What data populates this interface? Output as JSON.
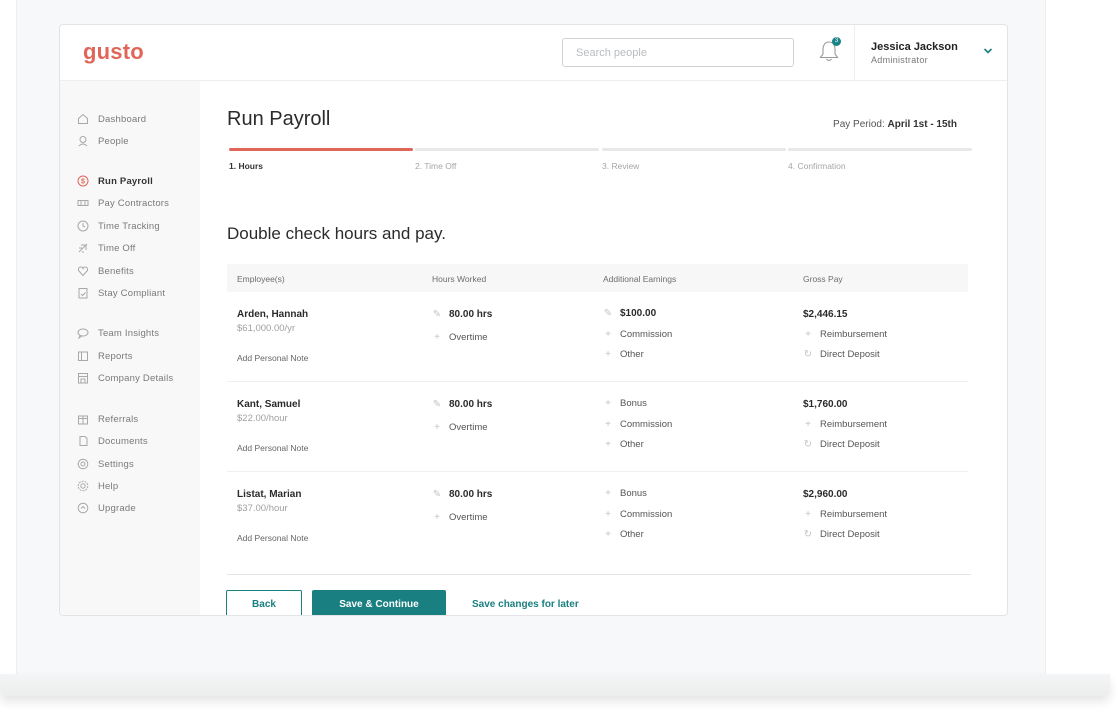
{
  "header": {
    "logo": "gusto",
    "search_placeholder": "Search people",
    "notification_count": "3",
    "user_name": "Jessica Jackson",
    "user_role": "Administrator"
  },
  "sidebar": {
    "items": [
      {
        "label": "Dashboard",
        "icon": "home-icon"
      },
      {
        "label": "People",
        "icon": "person-icon"
      },
      {
        "label": "Run Payroll",
        "icon": "dollar-icon",
        "active": true
      },
      {
        "label": "Pay Contractors",
        "icon": "cash-icon"
      },
      {
        "label": "Time Tracking",
        "icon": "clock-icon"
      },
      {
        "label": "Time Off",
        "icon": "airplane-icon"
      },
      {
        "label": "Benefits",
        "icon": "heart-icon"
      },
      {
        "label": "Stay Compliant",
        "icon": "clipboard-check-icon"
      },
      {
        "label": "Team Insights",
        "icon": "chat-bubble-icon"
      },
      {
        "label": "Reports",
        "icon": "folder-icon"
      },
      {
        "label": "Company Details",
        "icon": "building-icon"
      },
      {
        "label": "Referrals",
        "icon": "gift-icon"
      },
      {
        "label": "Documents",
        "icon": "document-icon"
      },
      {
        "label": "Settings",
        "icon": "gear-icon"
      },
      {
        "label": "Help",
        "icon": "help-icon"
      },
      {
        "label": "Upgrade",
        "icon": "upgrade-icon"
      }
    ]
  },
  "main": {
    "title": "Run Payroll",
    "pay_period_label": "Pay Period:",
    "pay_period_value": "April 1st - 15th",
    "steps": [
      {
        "label": "1. Hours",
        "complete": true
      },
      {
        "label": "2. Time Off",
        "complete": false
      },
      {
        "label": "3. Review",
        "complete": false
      },
      {
        "label": "4. Confirmation",
        "complete": false
      }
    ],
    "subtitle": "Double check hours and pay.",
    "table": {
      "headers": [
        "Employee(s)",
        "Hours Worked",
        "Additional Earnings",
        "Gross Pay"
      ],
      "rows": [
        {
          "name": "Arden, Hannah",
          "rate": "$61,000.00/yr",
          "note": "Add Personal Note",
          "hours": "80.00 hrs",
          "overtime": "Overtime",
          "earnings": [
            "$100.00",
            "Commission",
            "Other"
          ],
          "gross": "$2,446.15",
          "reimbursement": "Reimbursement",
          "deposit": "Direct Deposit"
        },
        {
          "name": "Kant, Samuel",
          "rate": "$22.00/hour",
          "note": "Add Personal Note",
          "hours": "80.00 hrs",
          "overtime": "Overtime",
          "earnings": [
            "Bonus",
            "Commission",
            "Other"
          ],
          "gross": "$1,760.00",
          "reimbursement": "Reimbursement",
          "deposit": "Direct Deposit"
        },
        {
          "name": "Listat, Marian",
          "rate": "$37.00/hour",
          "note": "Add Personal Note",
          "hours": "80.00 hrs",
          "overtime": "Overtime",
          "earnings": [
            "Bonus",
            "Commission",
            "Other"
          ],
          "gross": "$2,960.00",
          "reimbursement": "Reimbursement",
          "deposit": "Direct Deposit"
        }
      ]
    },
    "buttons": {
      "back": "Back",
      "save_continue": "Save & Continue",
      "save_later": "Save changes for later"
    }
  },
  "colors": {
    "brand": "#e0665a",
    "accent": "#1a7f80"
  }
}
